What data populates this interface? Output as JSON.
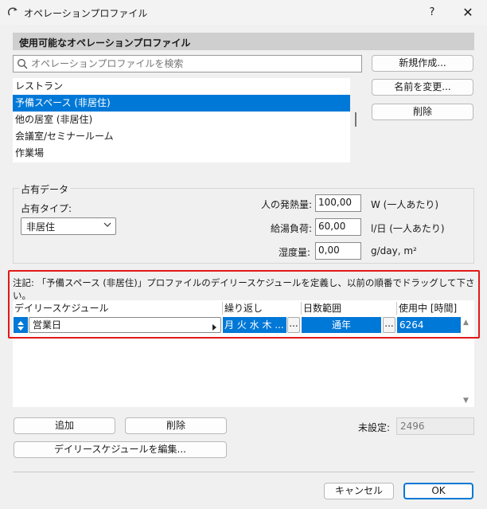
{
  "window": {
    "title": "オペレーションプロファイル",
    "help": "?",
    "close": "✕"
  },
  "profiles": {
    "heading": "使用可能なオペレーションプロファイル",
    "search_placeholder": "オペレーションプロファイルを検索",
    "items": [
      {
        "label": "レストラン",
        "selected": false
      },
      {
        "label": "予備スペース (非居住)",
        "selected": true
      },
      {
        "label": "他の居室 (非居住)",
        "selected": false
      },
      {
        "label": "会議室/セミナールーム",
        "selected": false
      },
      {
        "label": "作業場",
        "selected": false
      }
    ],
    "buttons": {
      "new": "新規作成...",
      "rename": "名前を変更...",
      "delete": "削除"
    }
  },
  "occupancy": {
    "group_label": "占有データ",
    "type_label": "占有タイプ:",
    "type_value": "非居住",
    "heat_label": "人の発熱量:",
    "heat_value": "100,00",
    "heat_unit": "W (一人あたり)",
    "water_label": "給湯負荷:",
    "water_value": "60,00",
    "water_unit": "l/日 (一人あたり)",
    "humidity_label": "湿度量:",
    "humidity_value": "0,00",
    "humidity_unit": "g/day, m²"
  },
  "schedule": {
    "note": "注記: 「予備スペース (非居住)」プロファイルのデイリースケジュールを定義し、以前の順番でドラッグして下さい。",
    "columns": {
      "daily": "デイリースケジュール",
      "repeat": "繰り返し",
      "days": "日数範囲",
      "inuse": "使用中 [時間]"
    },
    "row": {
      "daily": "営業日",
      "repeat": "月 火 水 木 ...",
      "days": "通年",
      "inuse": "6264"
    },
    "ellipsis": "...",
    "add": "追加",
    "delete": "削除",
    "edit": "デイリースケジュールを編集...",
    "unset_label": "未設定:",
    "unset_value": "2496"
  },
  "footer": {
    "cancel": "キャンセル",
    "ok": "OK"
  },
  "colors": {
    "accent": "#0078d7",
    "highlight_border": "#e11919"
  }
}
